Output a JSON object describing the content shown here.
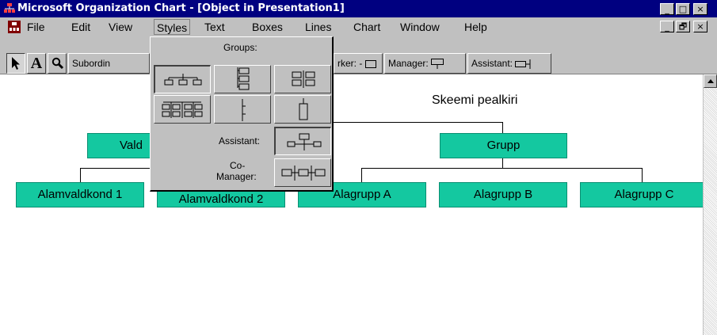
{
  "window": {
    "title": "Microsoft Organization Chart - [Object in Presentation1]",
    "controls": [
      "_",
      "□",
      "×"
    ],
    "doc_controls": [
      "_",
      "🗗",
      "×"
    ]
  },
  "menu": {
    "file": "File",
    "edit": "Edit",
    "view": "View",
    "styles": "Styles",
    "text": "Text",
    "boxes": "Boxes",
    "lines": "Lines",
    "chart": "Chart",
    "window": "Window",
    "help": "Help"
  },
  "toolbar": {
    "select_icon": "arrow-pointer-icon",
    "text_tool": "A",
    "zoom_icon": "magnifier-icon",
    "subordinate": "Subordin",
    "coworker": "rker: -",
    "manager": "Manager:",
    "assistant": "Assistant:"
  },
  "styles_menu": {
    "groups_label": "Groups:",
    "assistant_label": "Assistant:",
    "comanager_label_1": "Co-",
    "comanager_label_2": "Manager:"
  },
  "chart": {
    "title": "Skeemi pealkiri",
    "boxes": {
      "vald": "Vald",
      "grupp": "Grupp",
      "alamvaldkond1": "Alamvaldkond 1",
      "alamvaldkond2": "Alamvaldkond 2",
      "alagrupp_a": "Alagrupp A",
      "alagrupp_b": "Alagrupp B",
      "alagrupp_c": "Alagrupp C"
    },
    "box_color": "#14c8a0"
  }
}
